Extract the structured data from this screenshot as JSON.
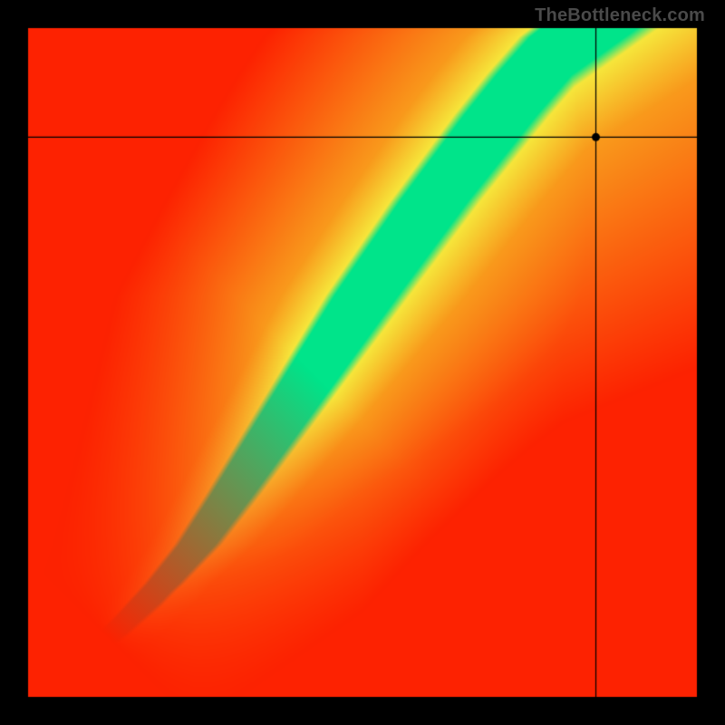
{
  "watermark": "TheBottleneck.com",
  "chart_data": {
    "type": "heatmap",
    "title": "",
    "xlabel": "",
    "ylabel": "",
    "xlim": [
      0,
      1
    ],
    "ylim": [
      0,
      1
    ],
    "marker": {
      "x": 0.848,
      "y": 0.836
    },
    "crosshair": {
      "x": 0.848,
      "y": 0.836
    },
    "optimal_curve": {
      "description": "Green optimal band center; y as function of x (normalized 0-1)",
      "points": [
        {
          "x": 0.0,
          "y": 0.0
        },
        {
          "x": 0.05,
          "y": 0.035
        },
        {
          "x": 0.1,
          "y": 0.075
        },
        {
          "x": 0.15,
          "y": 0.12
        },
        {
          "x": 0.2,
          "y": 0.17
        },
        {
          "x": 0.25,
          "y": 0.228
        },
        {
          "x": 0.3,
          "y": 0.3
        },
        {
          "x": 0.35,
          "y": 0.375
        },
        {
          "x": 0.4,
          "y": 0.45
        },
        {
          "x": 0.45,
          "y": 0.525
        },
        {
          "x": 0.5,
          "y": 0.6
        },
        {
          "x": 0.55,
          "y": 0.67
        },
        {
          "x": 0.6,
          "y": 0.74
        },
        {
          "x": 0.65,
          "y": 0.805
        },
        {
          "x": 0.7,
          "y": 0.87
        },
        {
          "x": 0.75,
          "y": 0.93
        },
        {
          "x": 0.8,
          "y": 0.985
        },
        {
          "x": 0.82,
          "y": 1.0
        }
      ]
    },
    "band_half_width": {
      "description": "Approximate half-width of green band perpendicular to curve, normalized units, varies along curve",
      "at_0": 0.008,
      "at_mid": 0.055,
      "at_end": 0.075
    },
    "color_scale": {
      "optimal": "#00e48a",
      "near": "#f6e63b",
      "mid": "#f99a1c",
      "far": "#fd221"
    }
  }
}
